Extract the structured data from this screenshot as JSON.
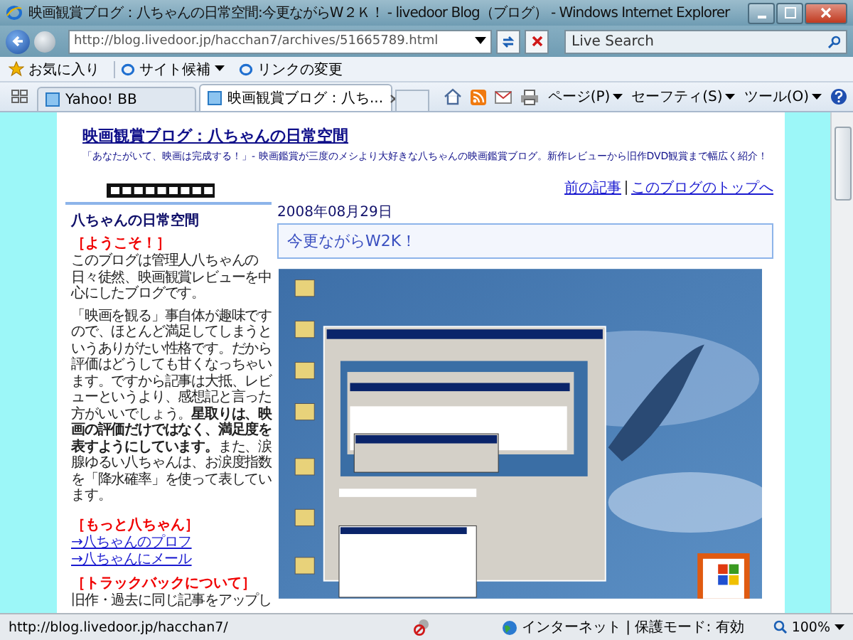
{
  "window": {
    "title": "映画観賞ブログ：八ちゃんの日常空間:今更ながらW２Ｋ！ - livedoor Blog（ブログ） - Windows Internet Explorer"
  },
  "nav": {
    "url": "http://blog.livedoor.jp/hacchan7/archives/51665789.html",
    "search_placeholder": "Live Search"
  },
  "favorites_bar": [
    {
      "label": "お気に入り",
      "kind": "favorites"
    },
    {
      "label": "サイト候補",
      "kind": "dropdown"
    },
    {
      "label": "リンクの変更",
      "kind": "link"
    }
  ],
  "tabs": [
    {
      "label": "Yahoo! BB",
      "selected": false
    },
    {
      "label": "映画観賞ブログ：八ち...",
      "selected": true
    }
  ],
  "command_bar": [
    "ページ(P)",
    "セーフティ(S)",
    "ツール(O)"
  ],
  "blog": {
    "title": "映画観賞ブログ：八ちゃんの日常空間",
    "tagline": "「あなたがいて、映画は完成する！」- 映画鑑賞が三度のメシより大好きな八ちゃんの映画鑑賞ブログ。新作レビューから旧作DVD観賞まで幅広く紹介！",
    "nav_links": [
      "前の記事",
      "このブログのトップへ"
    ]
  },
  "sidebar": {
    "title": "八ちゃんの日常空間",
    "sections": [
      {
        "heading": "［ようこそ！］",
        "paragraphs": [
          "このブログは管理人八ちゃんの日々徒然、映画観賞レビューを中心にしたブログです。",
          "「映画を観る」事自体が趣味ですので、ほとんど満足してしまうというありがたい性格です。だから評価はどうしても甘くなっちゃいます。ですから記事は大抵、レビューというより、感想記と言った方がいいでしょう。**星取りは、映画の評価だけではなく、満足度を表すようにしています。**また、涙腺ゆるい八ちゃんは、お涙度指数を「降水確率」を使って表しています。"
        ]
      },
      {
        "heading": "［もっと八ちゃん］",
        "links": [
          "→八ちゃんのプロフ",
          "→八ちゃんにメール"
        ]
      },
      {
        "heading": "［トラックバックについて］",
        "paragraphs": [
          "旧作・過去に同じ記事をアップし"
        ]
      }
    ]
  },
  "post": {
    "date": "2008年08月29日",
    "title": "今更ながらW2K！"
  },
  "status_bar": {
    "url": "http://blog.livedoor.jp/hacchan7/",
    "zone": "インターネット | 保護モード: 有効",
    "zoom": "100%"
  }
}
